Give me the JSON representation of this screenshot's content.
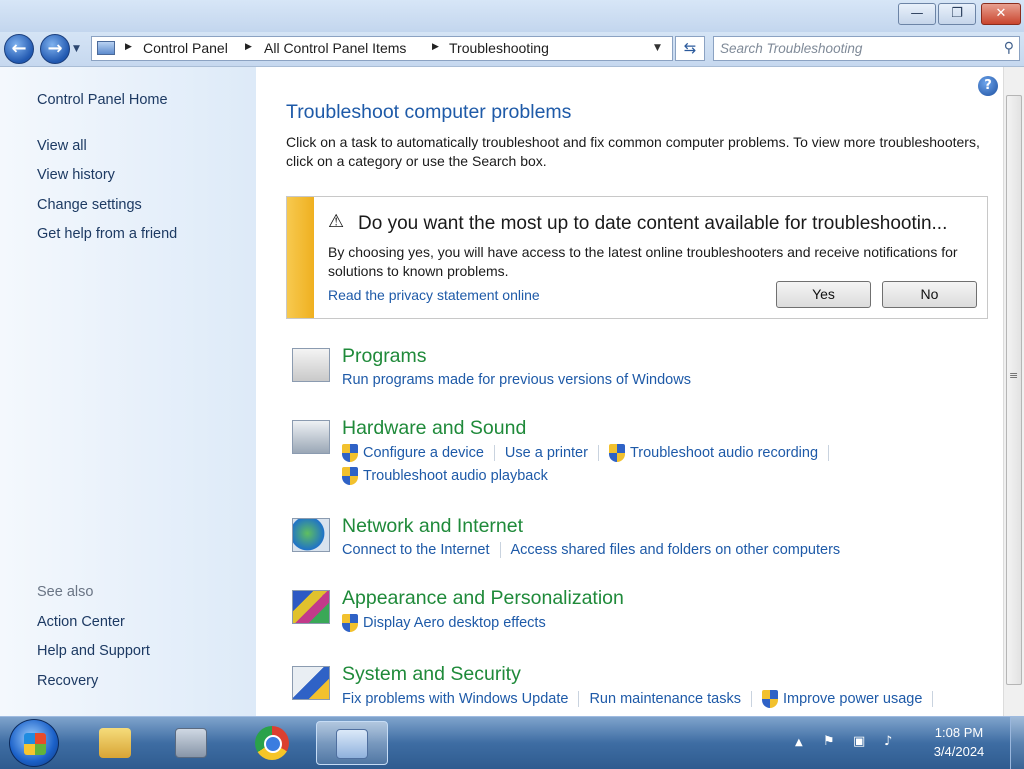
{
  "window": {
    "controls": {
      "minimize": "—",
      "maximize": "❐",
      "close": "✕"
    }
  },
  "nav": {
    "back_glyph": "←",
    "forward_glyph": "→",
    "breadcrumb": [
      "Control Panel",
      "All Control Panel Items",
      "Troubleshooting"
    ],
    "search_placeholder": "Search Troubleshooting"
  },
  "left_pane": {
    "home": "Control Panel Home",
    "links": [
      "View all",
      "View history",
      "Change settings",
      "Get help from a friend"
    ],
    "see_also_label": "See also",
    "see_also": [
      "Action Center",
      "Help and Support",
      "Recovery"
    ]
  },
  "main": {
    "title": "Troubleshoot computer problems",
    "description": "Click on a task to automatically troubleshoot and fix common computer problems. To view more troubleshooters, click on a category or use the Search box.",
    "notice": {
      "heading": "Do you want the most up to date content available for troubleshootin...",
      "body": "By choosing yes, you will have access to the latest online troubleshooters and receive notifications for solutions to known problems.",
      "link": "Read the privacy statement online",
      "yes": "Yes",
      "no": "No"
    },
    "categories": [
      {
        "title": "Programs",
        "tasks": [
          "Run programs made for previous versions of Windows"
        ]
      },
      {
        "title": "Hardware and Sound",
        "tasks": [
          "Configure a device",
          "Use a printer",
          "Troubleshoot audio recording",
          "Troubleshoot audio playback"
        ]
      },
      {
        "title": "Network and Internet",
        "tasks": [
          "Connect to the Internet",
          "Access shared files and folders on other computers"
        ]
      },
      {
        "title": "Appearance and Personalization",
        "tasks": [
          "Display Aero desktop effects"
        ]
      },
      {
        "title": "System and Security",
        "tasks": [
          "Fix problems with Windows Update",
          "Run maintenance tasks",
          "Improve power usage"
        ]
      }
    ]
  },
  "taskbar": {
    "time": "1:08 PM",
    "date": "3/4/2024",
    "apps": [
      "windows-explorer",
      "calculator",
      "chrome",
      "control-panel"
    ]
  },
  "colors": {
    "link_blue": "#1e5aa8",
    "category_green": "#1f8a3a",
    "warning_bar": "#efb020"
  }
}
